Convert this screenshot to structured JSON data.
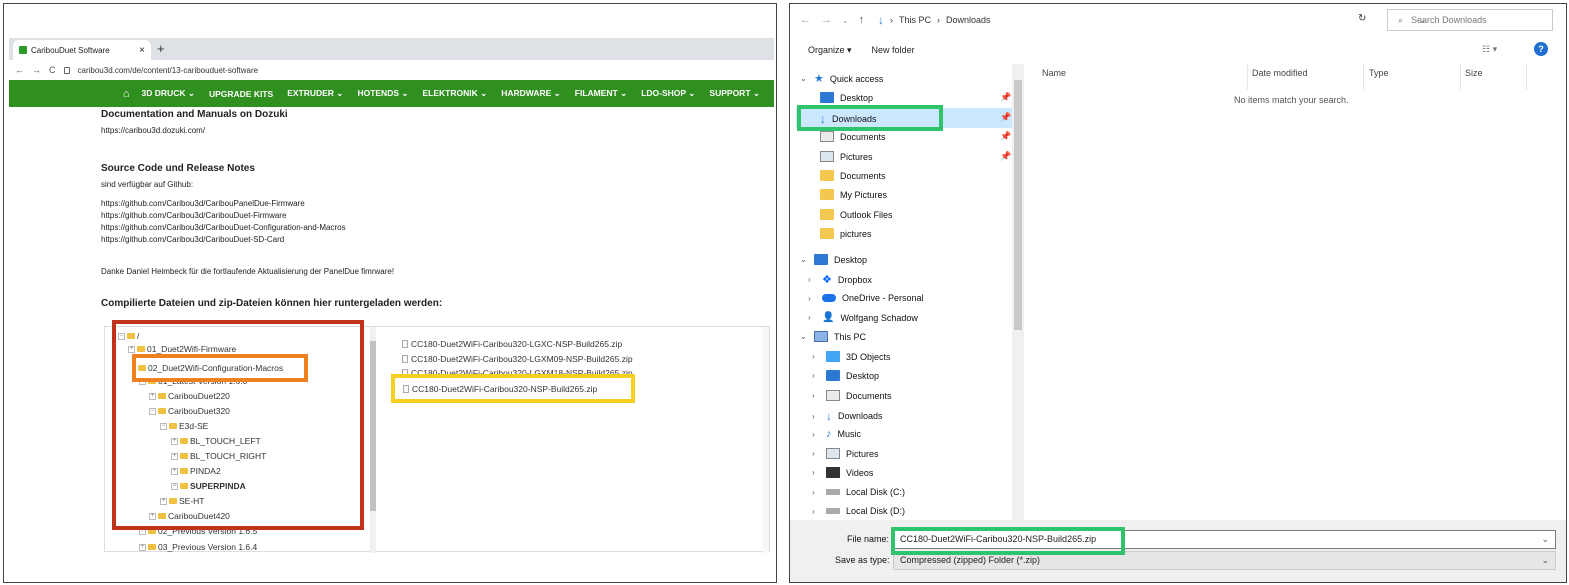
{
  "browser": {
    "tab_title": "CaribouDuet Software",
    "tab_close": "×",
    "new_tab": "+",
    "back": "←",
    "forward": "→",
    "reload": "C",
    "url": "caribou3d.com/de/content/13-caribouduet-software",
    "menu": [
      "3D DRUCK ⌄",
      "UPGRADE KITS",
      "EXTRUDER ⌄",
      "HOTENDS ⌄",
      "ELEKTRONIK ⌄",
      "HARDWARE ⌄",
      "FILAMENT ⌄",
      "LDO-SHOP ⌄",
      "SUPPORT ⌄"
    ],
    "home": "⌂"
  },
  "content": {
    "h_docs": "Documentation and Manuals on Dozuki",
    "docs_link": "https://caribou3d.dozuki.com/",
    "h_source": "Source Code und Release Notes",
    "source_intro": "sind verfügbar auf Github:",
    "links": [
      "https://github.com/Caribou3d/CaribouPanelDue-Firmware",
      "https://github.com/Caribou3d/CaribouDuet-Firmware",
      "https://github.com/Caribou3d/CaribouDuet-Configuration-and-Macros",
      "https://github.com/Caribou3d/CaribouDuet-SD-Card"
    ],
    "thanks": "Danke Daniel Heimbeck für die fortlaufende Aktualisierung der PanelDue fimrware!",
    "h_files": "Compilierte Dateien und zip-Dateien können hier runtergeladen werden:"
  },
  "tree": {
    "root": "/",
    "n01": "01_Duet2Wifi-Firmware",
    "n02": "02_Duet2Wifi-Configuration-Macros",
    "n_latest": "01_Latest Version 1.6.0",
    "n220": "CaribouDuet220",
    "n320": "CaribouDuet320",
    "ne3d": "E3d-SE",
    "nbl_left": "BL_TOUCH_LEFT",
    "nbl_right": "BL_TOUCH_RIGHT",
    "npinda2": "PINDA2",
    "nsuper": "SUPERPINDA",
    "nseht": "SE-HT",
    "n420": "CaribouDuet420",
    "nprev": "02_Previous Version 1.6.5",
    "nprev2": "03_Previous Version 1.6.4"
  },
  "files": [
    "CC180-Duet2WiFi-Caribou320-LGXC-NSP-Build265.zip",
    "CC180-Duet2WiFi-Caribou320-LGXM09-NSP-Build265.zip",
    "CC180-Duet2WiFi-Caribou320-LGXM18-NSP-Build265.zip",
    "CC180-Duet2WiFi-Caribou320-NSP-Build265.zip"
  ],
  "explorer": {
    "path": [
      "This PC",
      "Downloads"
    ],
    "search_placeholder": "Search Downloads",
    "organize": "Organize ▾",
    "new_folder": "New folder",
    "help": "?",
    "view": "☷ ▾",
    "columns": [
      "Name",
      "Date modified",
      "Type",
      "Size"
    ],
    "empty": "No items match your search.",
    "quick_access": "Quick access",
    "qa_items": [
      "Desktop",
      "Downloads",
      "Documents",
      "Pictures",
      "Documents",
      "My Pictures",
      "Outlook Files",
      "pictures"
    ],
    "desktop": "Desktop",
    "desktop_items": [
      "Dropbox",
      "OneDrive - Personal",
      "Wolfgang Schadow"
    ],
    "this_pc": "This PC",
    "pc_items": [
      "3D Objects",
      "Desktop",
      "Documents",
      "Downloads",
      "Music",
      "Pictures",
      "Videos",
      "Local Disk (C:)",
      "Local Disk (D:)"
    ],
    "file_name_label": "File name:",
    "file_name_value": "CC180-Duet2WiFi-Caribou320-NSP-Build265.zip",
    "save_type_label": "Save as type:",
    "save_type_value": "Compressed (zipped) Folder (*.zip)"
  },
  "colors": {
    "menu_green": "#2f8f1f",
    "red": "#c0321a",
    "orange": "#f08020",
    "yellow": "#f5d020",
    "green": "#2fc36b"
  }
}
